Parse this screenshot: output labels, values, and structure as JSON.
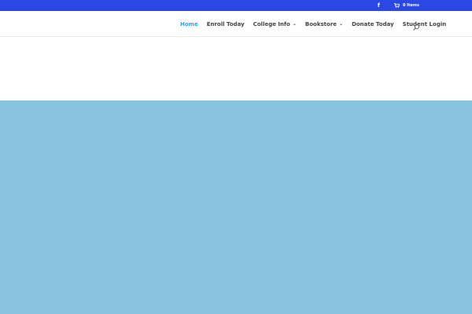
{
  "top_bar": {
    "bg_color": "#2b48e5",
    "facebook_icon": "f",
    "cart_icon": "shopping-cart-icon",
    "cart_label": "0 Items"
  },
  "nav": {
    "active_color": "#2ea3f2",
    "items": [
      {
        "label": "Home",
        "active": true,
        "dropdown": false
      },
      {
        "label": "Enroll Today",
        "active": false,
        "dropdown": false
      },
      {
        "label": "College Info",
        "active": false,
        "dropdown": true
      },
      {
        "label": "Bookstore",
        "active": false,
        "dropdown": true
      },
      {
        "label": "Donate Today",
        "active": false,
        "dropdown": false
      },
      {
        "label": "Student Login",
        "active": false,
        "dropdown": false
      }
    ],
    "search_icon": "search-icon"
  },
  "hero": {
    "bg_color": "#88c3df"
  }
}
